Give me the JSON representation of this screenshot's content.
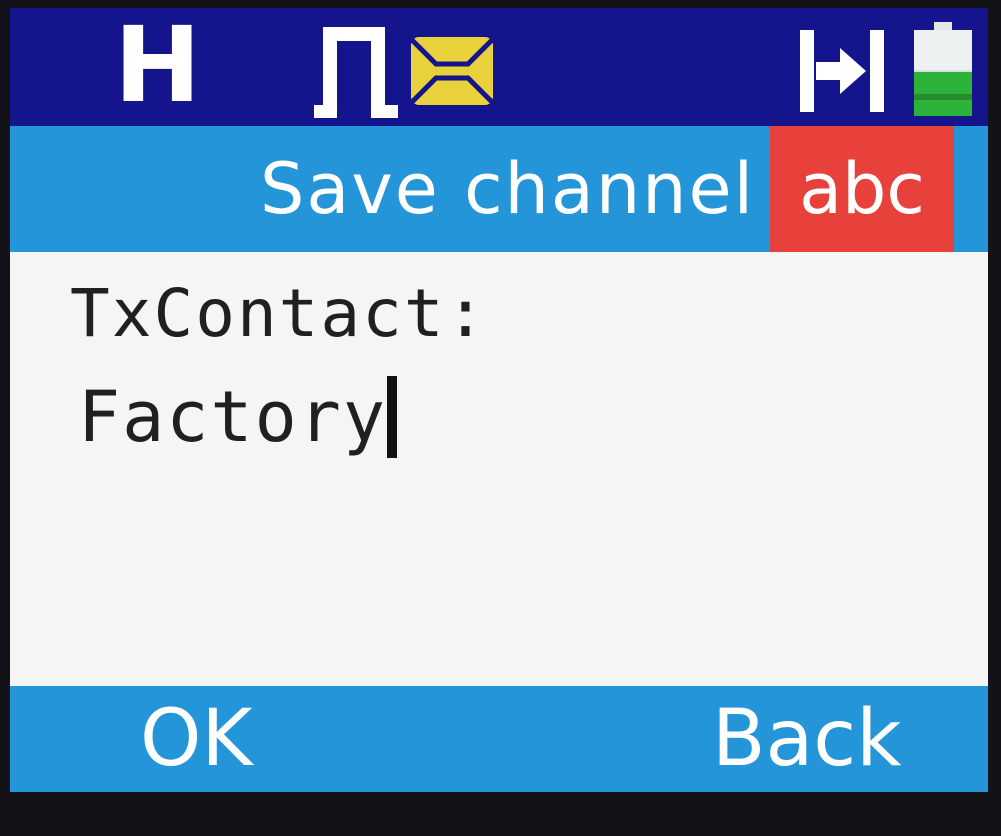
{
  "status_bar": {
    "power_level": "H",
    "indicators": [
      "wave-icon",
      "message-icon",
      "power-toggle-icon",
      "battery-icon"
    ],
    "battery_level": 0.5
  },
  "header": {
    "title": "Save channel",
    "input_mode": "abc"
  },
  "field": {
    "label": "TxContact:",
    "value": "Factory"
  },
  "softkeys": {
    "left": "OK",
    "right": "Back"
  },
  "colors": {
    "status_bar": "#14148c",
    "header": "#2595d9",
    "input_mode_badge": "#e8413c",
    "content": "#f5f5f3",
    "message_icon": "#e8d13a",
    "battery_fill": "#2bb33a"
  }
}
